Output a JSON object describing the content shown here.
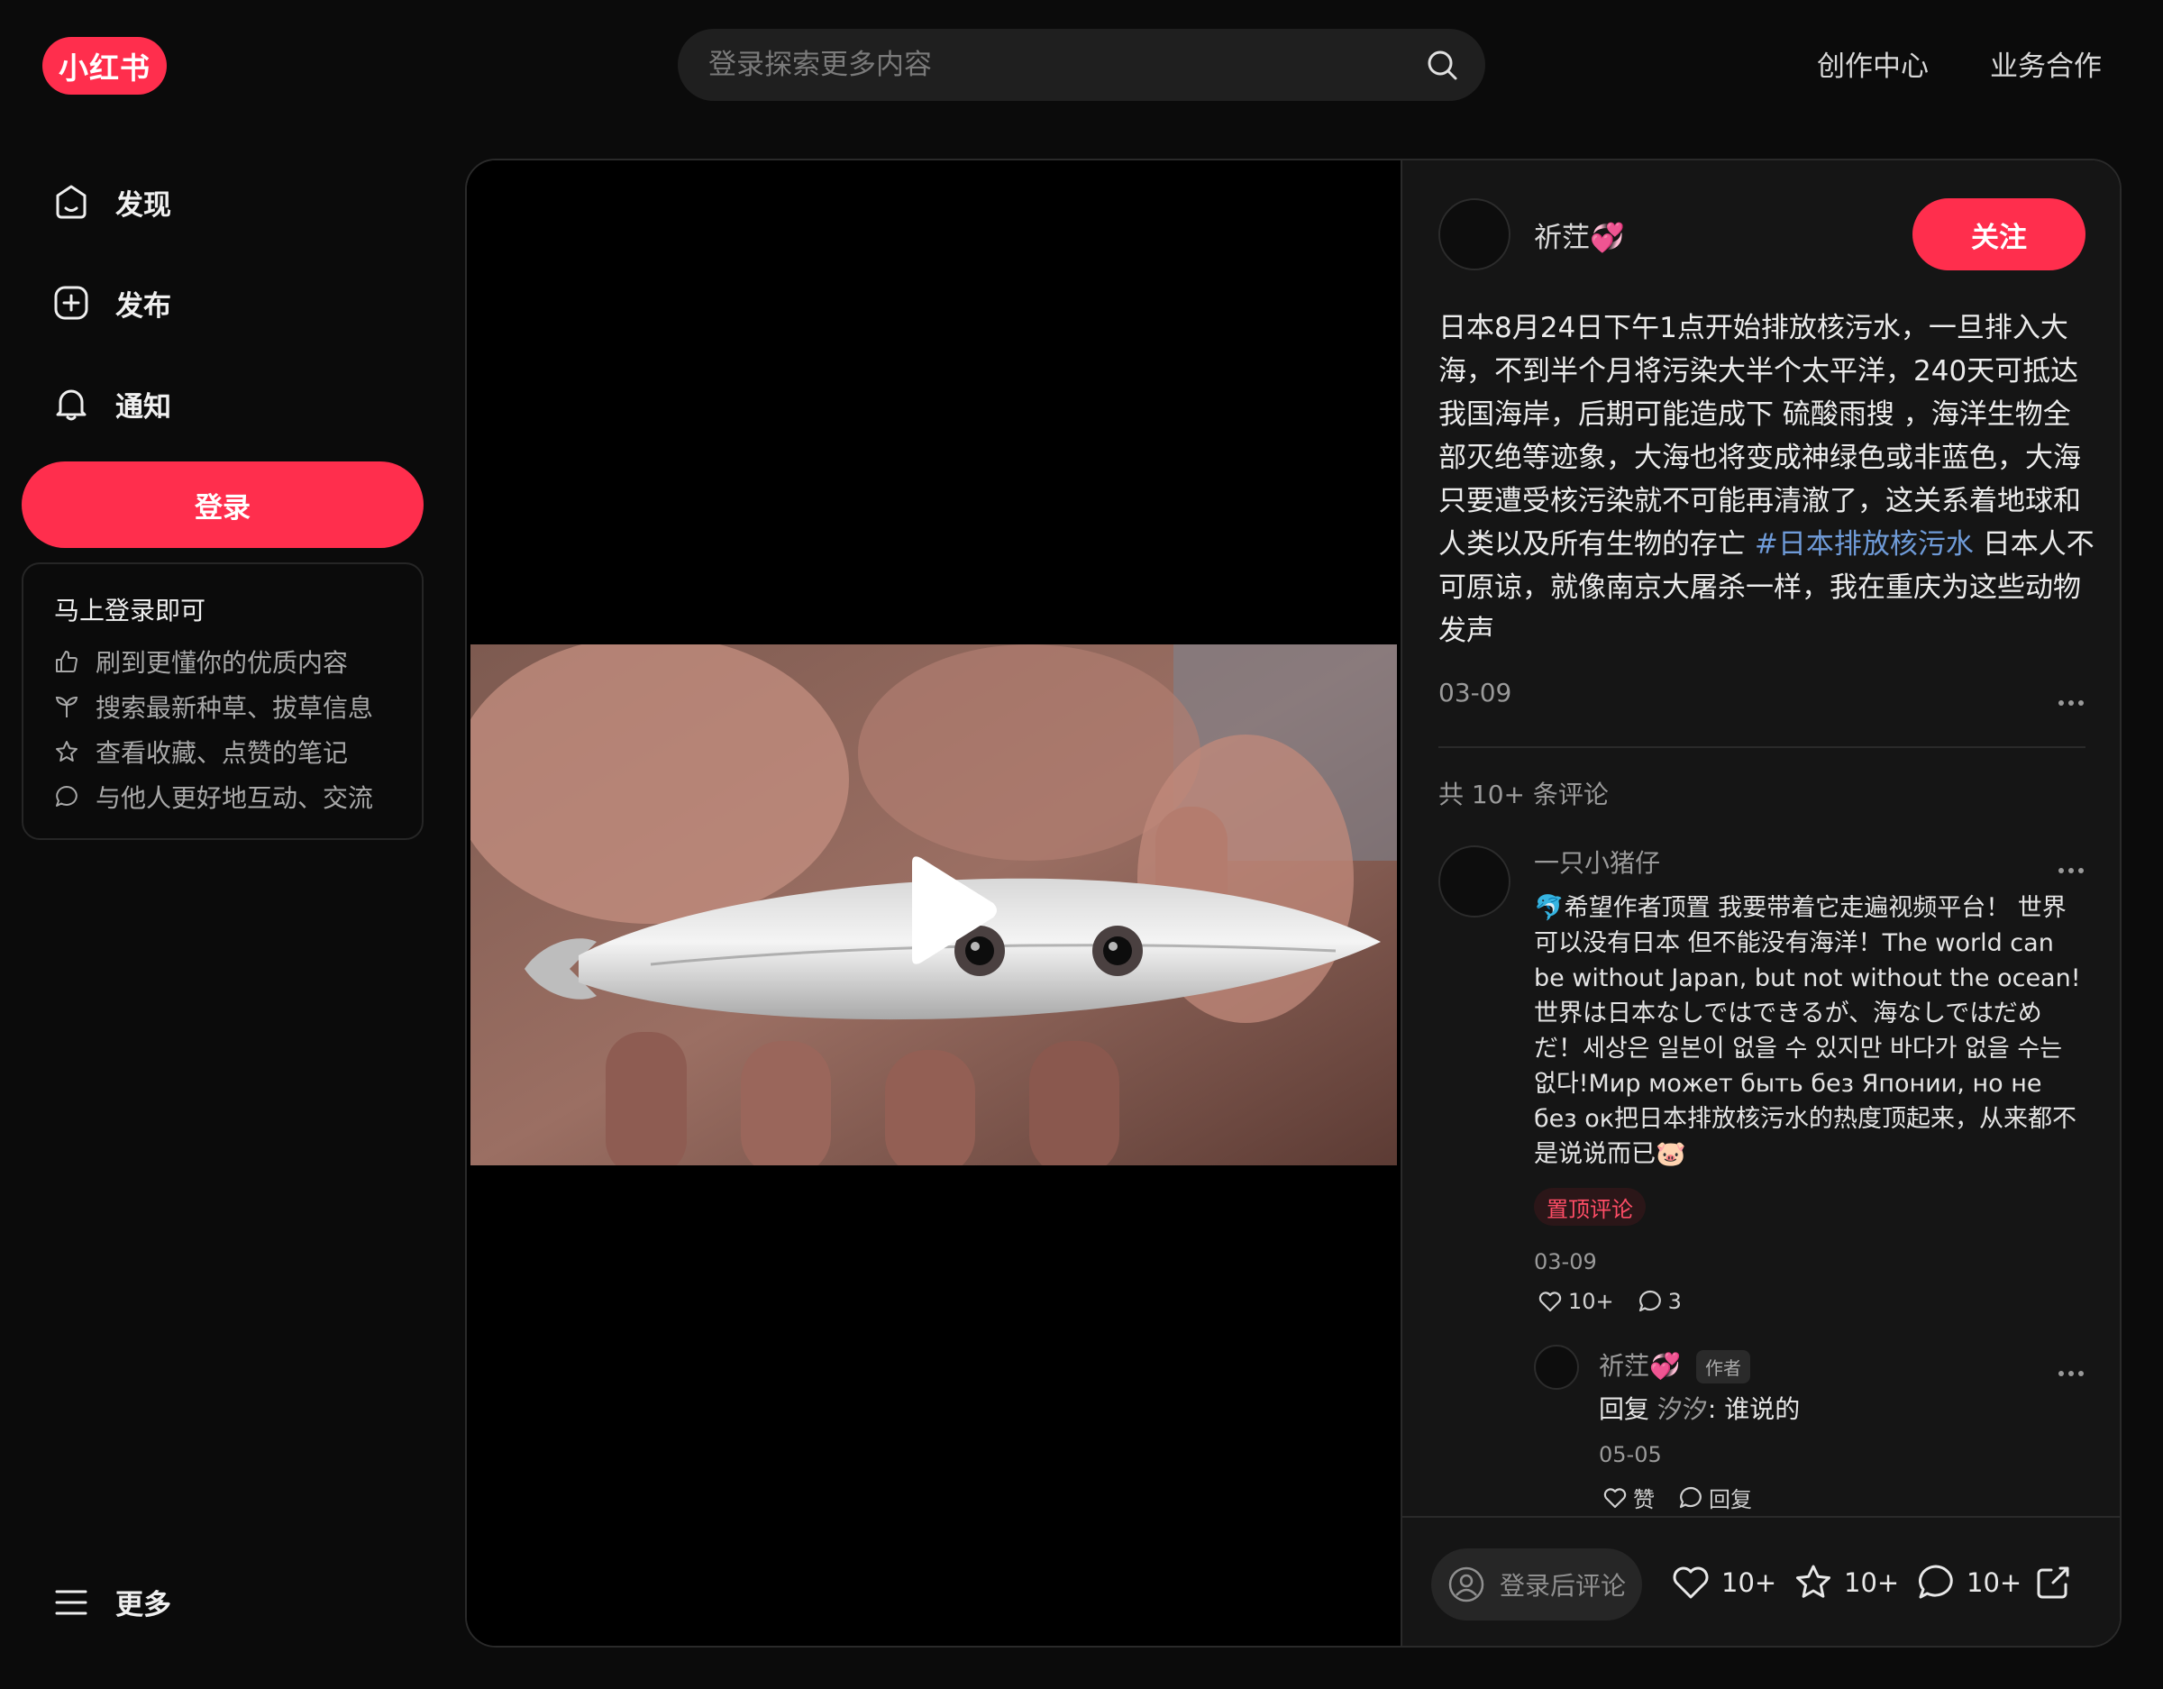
{
  "header": {
    "logo": "小红书",
    "search_placeholder": "登录探索更多内容",
    "links": [
      "创作中心",
      "业务合作"
    ]
  },
  "sidebar": {
    "items": [
      {
        "label": "发现",
        "icon": "home-icon"
      },
      {
        "label": "发布",
        "icon": "plus-square-icon"
      },
      {
        "label": "通知",
        "icon": "bell-icon"
      }
    ],
    "login_label": "登录",
    "promo": {
      "title": "马上登录即可",
      "items": [
        {
          "text": "刷到更懂你的优质内容",
          "icon": "thumbs-up-icon"
        },
        {
          "text": "搜索最新种草、拔草信息",
          "icon": "sprout-icon"
        },
        {
          "text": "查看收藏、点赞的笔记",
          "icon": "star-icon"
        },
        {
          "text": "与他人更好地互动、交流",
          "icon": "chat-bubble-icon"
        }
      ]
    },
    "more_label": "更多"
  },
  "note": {
    "author": "祈茳💞",
    "follow_label": "关注",
    "desc_text": "日本8月24日下午1点开始排放核污水，一旦排入大海，不到半个月将污染大半个太平洋，240天可抵达我国海岸，后期可能造成下 硫酸雨搜 ，海洋生物全部灭绝等迹象，大海也将变成神绿色或非蓝色，大海只要遭受核污染就不可能再清澈了，这关系着地球和人类以及所有生物的存亡 ",
    "desc_tag": "#日本排放核污水",
    "desc_tail": " 日本人不可原谅，就像南京大屠杀一样，我在重庆为这些动物发声",
    "date": "03-09",
    "comment_count": "共 10+ 条评论",
    "comments": [
      {
        "user": "一只小猪仔",
        "text": "🐬希望作者顶置 我要带着它走遍视频平台！ 世界可以没有日本 但不能没有海洋！The world can be without Japan, but not without the ocean!世界は日本なしではできるが、海なしではだめだ！세상은 일본이 없을 수 있지만 바다가 없을 수는 없다!Мир может быть без Японии, но не без ок把日本排放核污水的热度顶起来，从来都不是说说而已🐷",
        "pin_label": "置顶评论",
        "date": "03-09",
        "likes": "10+",
        "replies": "3"
      }
    ],
    "reply": {
      "user": "祈茳💞",
      "badge": "作者",
      "prefix": "回复 ",
      "target": "汐汐",
      "text": ": 谁说的",
      "date": "05-05",
      "like_label": "赞",
      "reply_label": "回复"
    },
    "bottom": {
      "comment_placeholder": "登录后评论",
      "likes": "10+",
      "collects": "10+",
      "comments": "10+"
    }
  }
}
